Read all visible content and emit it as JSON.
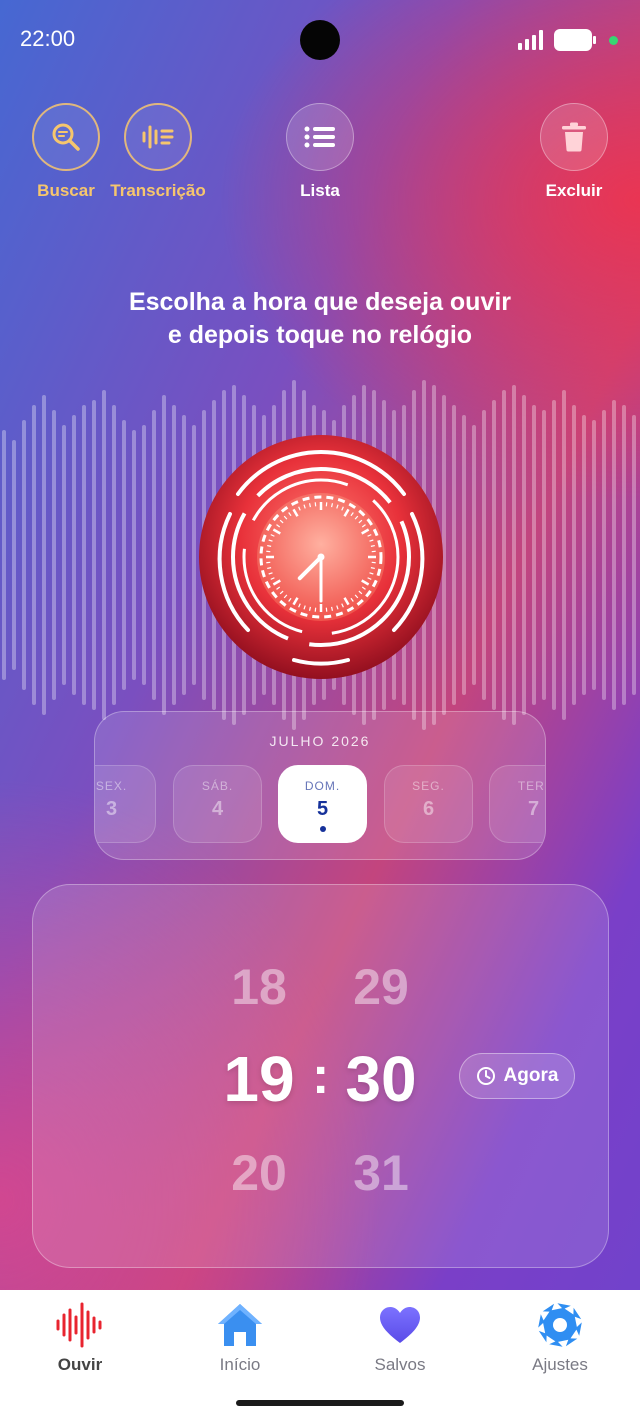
{
  "status_bar": {
    "time": "22:00"
  },
  "actions": {
    "search_label": "Buscar",
    "transcription_label": "Transcrição",
    "list_label": "Lista",
    "delete_label": "Excluir"
  },
  "headline": {
    "line1": "Escolha a hora que deseja ouvir",
    "line2": "e depois toque no relógio"
  },
  "clock": {
    "hour": 19,
    "minute": 30
  },
  "date_picker": {
    "month": "JULHO 2026",
    "days": [
      {
        "dow": "SEX.",
        "num": "3"
      },
      {
        "dow": "SÁB.",
        "num": "4"
      },
      {
        "dow": "DOM.",
        "num": "5",
        "selected": true
      },
      {
        "dow": "SEG.",
        "num": "6"
      },
      {
        "dow": "TER.",
        "num": "7"
      }
    ]
  },
  "time_picker": {
    "hour_prev": "18",
    "hour": "19",
    "hour_next": "20",
    "minute_prev": "29",
    "minute": "30",
    "minute_next": "31",
    "separator": ":",
    "now_label": "Agora"
  },
  "bottom_nav": {
    "items": [
      {
        "label": "Ouvir",
        "icon": "waveform-icon",
        "active": true
      },
      {
        "label": "Início",
        "icon": "home-icon"
      },
      {
        "label": "Salvos",
        "icon": "heart-icon"
      },
      {
        "label": "Ajustes",
        "icon": "gear-icon"
      }
    ]
  },
  "colors": {
    "accent_gold": "#f6c66d",
    "clock_red": "#e8313a",
    "selected_day_text": "#16319a"
  }
}
